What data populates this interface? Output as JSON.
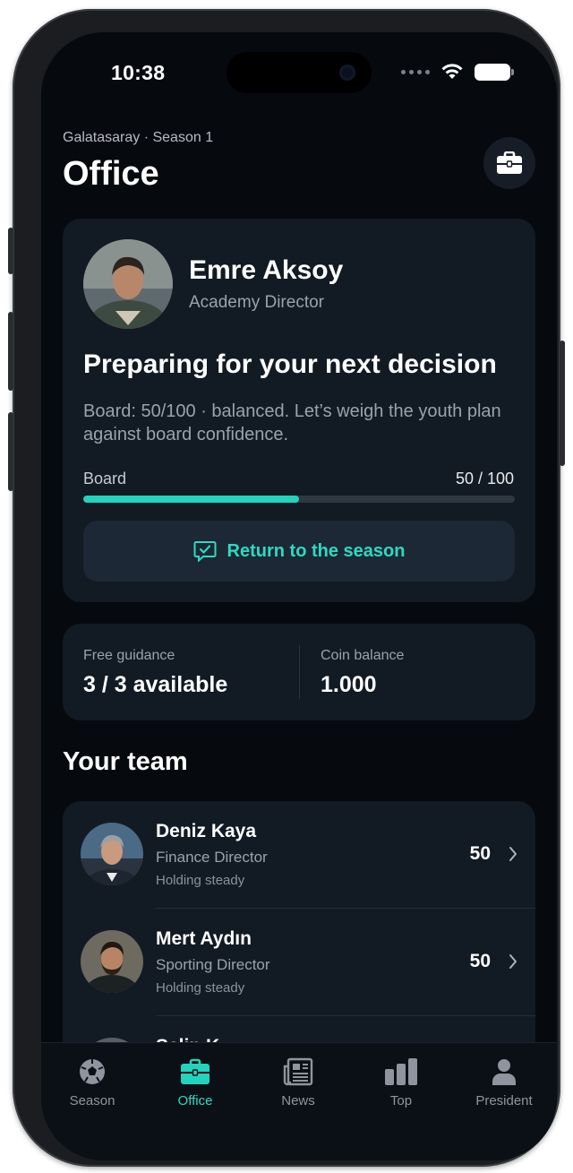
{
  "status_bar": {
    "time": "10:38"
  },
  "header": {
    "breadcrumb": "Galatasaray · Season 1",
    "title": "Office"
  },
  "advisor": {
    "name": "Emre Aksoy",
    "role": "Academy Director",
    "headline": "Preparing for your next decision",
    "description": "Board: 50/100 · balanced. Let’s weigh the youth plan against board confidence.",
    "board_label": "Board",
    "board_value_text": "50 / 100",
    "board_value": 50,
    "board_max": 100,
    "return_label": "Return to the season"
  },
  "stats": {
    "guidance_label": "Free guidance",
    "guidance_value": "3 / 3 available",
    "coins_label": "Coin balance",
    "coins_value": "1.000"
  },
  "team": {
    "title": "Your team",
    "members": [
      {
        "name": "Deniz Kaya",
        "role": "Finance Director",
        "status": "Holding steady",
        "score": "50"
      },
      {
        "name": "Mert Aydın",
        "role": "Sporting Director",
        "status": "Holding steady",
        "score": "50"
      },
      {
        "name": "Selin K",
        "role": "",
        "status": "",
        "score": ""
      }
    ]
  },
  "tabs": [
    {
      "label": "Season",
      "icon": "soccer-ball-icon",
      "active": false
    },
    {
      "label": "Office",
      "icon": "briefcase-icon",
      "active": true
    },
    {
      "label": "News",
      "icon": "newspaper-icon",
      "active": false
    },
    {
      "label": "Top",
      "icon": "bar-chart-icon",
      "active": false
    },
    {
      "label": "President",
      "icon": "person-icon",
      "active": false
    }
  ],
  "colors": {
    "accent": "#22d3be",
    "background": "#060a0f",
    "card": "#121a23"
  }
}
